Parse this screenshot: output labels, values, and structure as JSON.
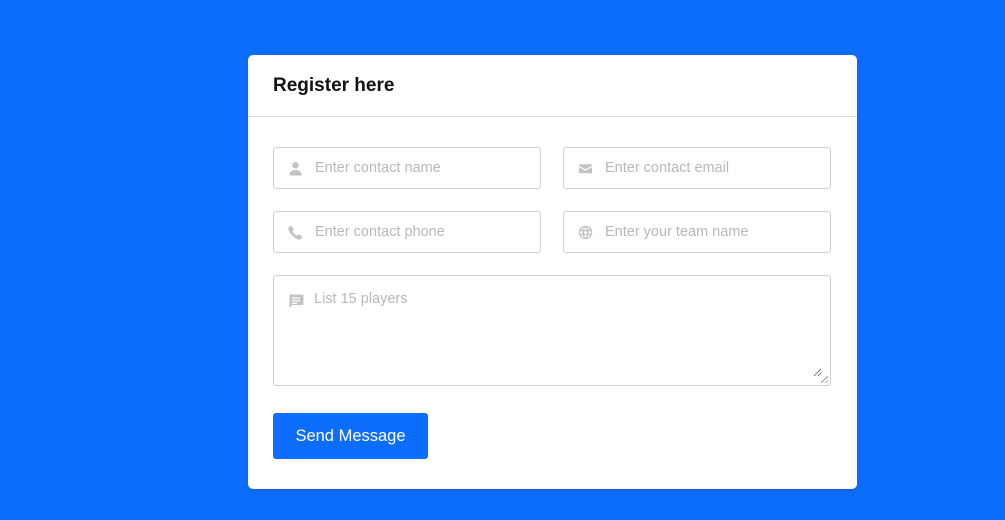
{
  "form": {
    "title": "Register here",
    "fields": {
      "contact_name": {
        "placeholder": "Enter contact name",
        "value": ""
      },
      "contact_email": {
        "placeholder": "Enter contact email",
        "value": ""
      },
      "contact_phone": {
        "placeholder": "Enter contact phone",
        "value": ""
      },
      "team_name": {
        "placeholder": "Enter your team name",
        "value": ""
      },
      "players": {
        "placeholder": "List 15 players",
        "value": ""
      }
    },
    "submit_label": "Send Message"
  },
  "icons": {
    "contact_name": "user-icon",
    "contact_email": "envelope-icon",
    "contact_phone": "phone-icon",
    "team_name": "globe-icon",
    "players": "comment-icon"
  },
  "colors": {
    "background": "#0d6efd",
    "button": "#0d6efd",
    "icon": "#c3c3c3"
  }
}
